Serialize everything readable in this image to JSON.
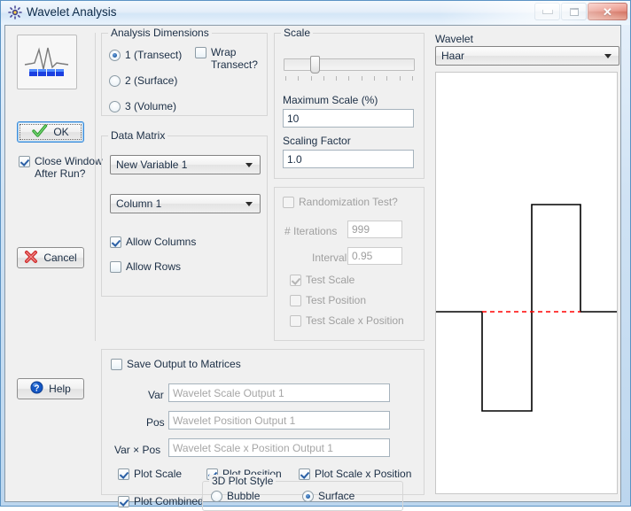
{
  "window": {
    "title": "Wavelet Analysis",
    "icon": "wavelet-app-icon",
    "buttons": {
      "minimize": "minimize-icon",
      "maximize": "maximize-icon",
      "close": "✕"
    }
  },
  "left_panel": {
    "preview_icon": "wavelet-waveform-icon",
    "ok_button": "OK",
    "close_after_run": {
      "label": "Close Window After Run?",
      "checked": true
    },
    "cancel_button": "Cancel",
    "help_button": "Help"
  },
  "analysis_dimensions": {
    "legend": "Analysis Dimensions",
    "options": [
      {
        "label": "1 (Transect)",
        "selected": true
      },
      {
        "label": "2 (Surface)",
        "selected": false
      },
      {
        "label": "3 (Volume)",
        "selected": false
      }
    ],
    "wrap_transect": {
      "label": "Wrap Transect?",
      "checked": false
    }
  },
  "data_matrix": {
    "legend": "Data Matrix",
    "variable_select": "New Variable 1",
    "column_select": "Column 1",
    "allow_columns": {
      "label": "Allow Columns",
      "checked": true
    },
    "allow_rows": {
      "label": "Allow Rows",
      "checked": false
    }
  },
  "scale": {
    "legend": "Scale",
    "slider_value_pct": 25,
    "tick_count": 11,
    "maximum_scale_label": "Maximum Scale (%)",
    "maximum_scale_value": "10",
    "scaling_factor_label": "Scaling Factor",
    "scaling_factor_value": "1.0"
  },
  "randomization": {
    "legend": "",
    "enabled": false,
    "checkbox_label": "Randomization Test?",
    "iterations_label": "# Iterations",
    "iterations_value": "999",
    "interval_label": "Interval",
    "interval_value": "0.95",
    "test_scale": {
      "label": "Test Scale",
      "checked": true
    },
    "test_position": {
      "label": "Test Position",
      "checked": false
    },
    "test_scale_x_position": {
      "label": "Test Scale x Position",
      "checked": false
    }
  },
  "save_output": {
    "legend": "",
    "checkbox_label": "Save Output to Matrices",
    "checked": false,
    "rows": [
      {
        "label": "Var",
        "placeholder": "Wavelet Scale Output 1"
      },
      {
        "label": "Pos",
        "placeholder": "Wavelet Position Output 1"
      },
      {
        "label": "Var × Pos",
        "placeholder": "Wavelet Scale x Position Output 1"
      }
    ],
    "plot_scale": {
      "label": "Plot Scale",
      "checked": true
    },
    "plot_position": {
      "label": "Plot Position",
      "checked": true
    },
    "plot_scale_x_position": {
      "label": "Plot Scale x Position",
      "checked": true
    },
    "plot_combined": {
      "label": "Plot Combined",
      "checked": true
    },
    "plot_style": {
      "legend": "3D Plot Style",
      "options": [
        {
          "label": "Bubble",
          "selected": false
        },
        {
          "label": "Surface",
          "selected": true
        }
      ]
    }
  },
  "wavelet": {
    "legend": "Wavelet",
    "selected": "Haar",
    "zero_line_color": "#ff0000",
    "curve_color": "#000000"
  },
  "chart_data": {
    "type": "line",
    "title": "Haar",
    "xlabel": "",
    "ylabel": "",
    "x": [
      0.0,
      0.25,
      0.25,
      0.5,
      0.5,
      0.75,
      0.75,
      1.0
    ],
    "y": [
      0,
      0,
      -1,
      -1,
      1,
      1,
      0,
      0
    ],
    "ylim": [
      -1.6,
      1.6
    ],
    "xlim": [
      0,
      1
    ],
    "grid": false,
    "legend_position": "none",
    "annotations": [
      {
        "type": "hline",
        "y": 0,
        "style": "dashed",
        "color": "#ff0000",
        "x_start": 0.25,
        "x_end": 0.75
      }
    ]
  }
}
